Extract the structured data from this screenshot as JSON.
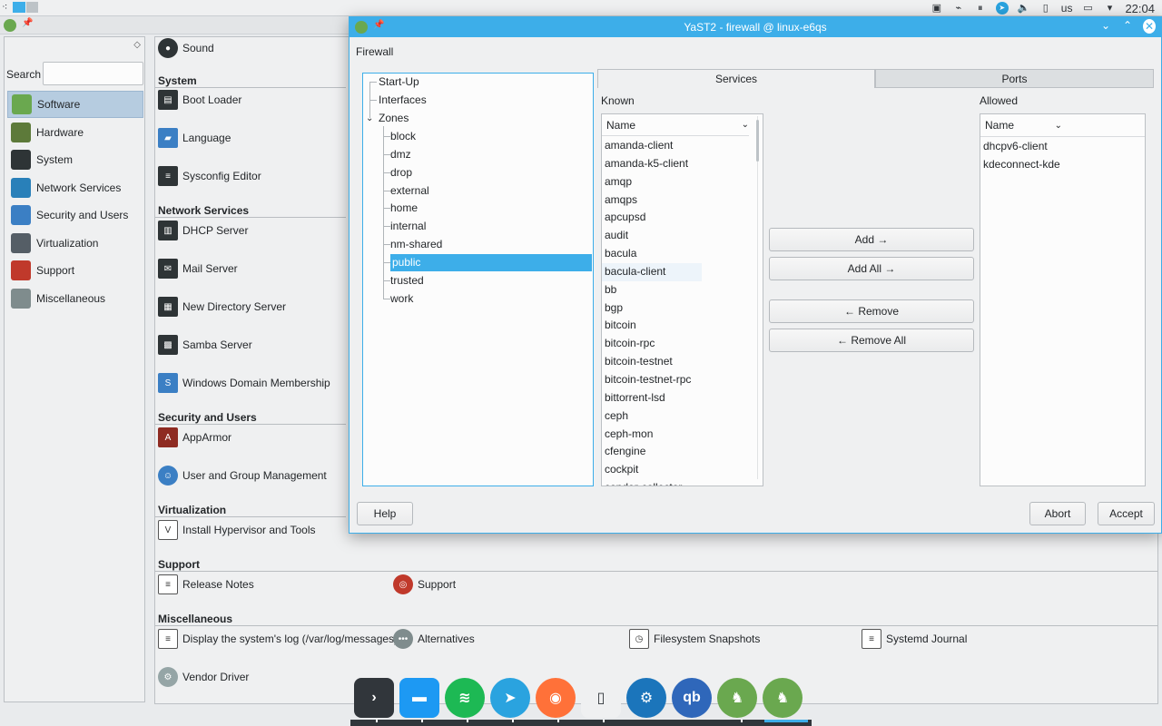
{
  "top_panel": {
    "keyboard_layout": "us",
    "clock": "22:04",
    "tray_icons": [
      "screenshot-icon",
      "network-icon",
      "pause-icon",
      "telegram-icon",
      "volume-icon",
      "battery-icon",
      "display-icon",
      "chevron-down-icon"
    ]
  },
  "control_center": {
    "search_label": "Search",
    "categories": [
      {
        "label": "Software",
        "icon": "software-icon",
        "color": "#6aa84f",
        "selected": true
      },
      {
        "label": "Hardware",
        "icon": "hardware-icon",
        "color": "#5d7a3a"
      },
      {
        "label": "System",
        "icon": "system-icon",
        "color": "#2e3436"
      },
      {
        "label": "Network Services",
        "icon": "globe-icon",
        "color": "#2980b9"
      },
      {
        "label": "Security and Users",
        "icon": "shield-icon",
        "color": "#3b7fc4"
      },
      {
        "label": "Virtualization",
        "icon": "virtualization-icon",
        "color": "#555e66"
      },
      {
        "label": "Support",
        "icon": "lifebuoy-icon",
        "color": "#c0392b"
      },
      {
        "label": "Miscellaneous",
        "icon": "more-icon",
        "color": "#7f8c8d"
      }
    ],
    "sections": {
      "system": "System",
      "network_services": "Network Services",
      "security_and_users": "Security and Users",
      "virtualization": "Virtualization",
      "support": "Support",
      "miscellaneous": "Miscellaneous"
    },
    "modules": {
      "sound": "Sound",
      "boot_loader": "Boot Loader",
      "language": "Language",
      "sysconfig_editor": "Sysconfig Editor",
      "dhcp_server": "DHCP Server",
      "mail_server": "Mail Server",
      "new_directory_server": "New Directory Server",
      "samba_server": "Samba Server",
      "windows_domain_membership": "Windows Domain Membership",
      "apparmor": "AppArmor",
      "user_group_management": "User and Group Management",
      "install_hypervisor": "Install Hypervisor and Tools",
      "release_notes": "Release Notes",
      "support": "Support",
      "system_log": "Display the system's log (/var/log/messages)",
      "alternatives": "Alternatives",
      "filesystem_snapshots": "Filesystem Snapshots",
      "systemd_journal": "Systemd Journal",
      "vendor_driver": "Vendor Driver"
    }
  },
  "dock": {
    "apps": [
      {
        "name": "konsole",
        "glyph": "›",
        "color": "#31363b"
      },
      {
        "name": "files",
        "glyph": "▬",
        "color": "#1d99f3"
      },
      {
        "name": "spotify",
        "glyph": "≋",
        "color": "#1db954"
      },
      {
        "name": "telegram",
        "glyph": "➤",
        "color": "#2aa3df"
      },
      {
        "name": "firefox",
        "glyph": "◉",
        "color": "#ff7139"
      },
      {
        "name": "kdeconnect",
        "glyph": "▯",
        "color": "#eff0f1"
      },
      {
        "name": "steam",
        "glyph": "⚙",
        "color": "#1b75bb"
      },
      {
        "name": "qbittorrent",
        "glyph": "qb",
        "color": "#2f67ba"
      },
      {
        "name": "yast",
        "glyph": "♞",
        "color": "#6aa84f"
      },
      {
        "name": "yast-2",
        "glyph": "♞",
        "color": "#6aa84f"
      }
    ]
  },
  "dialog": {
    "title": "YaST2 - firewall @ linux-e6qs",
    "heading": "Firewall",
    "tree": {
      "startup": "Start-Up",
      "interfaces": "Interfaces",
      "zones": "Zones",
      "zone_items": [
        "block",
        "dmz",
        "drop",
        "external",
        "home",
        "internal",
        "nm-shared",
        "public",
        "trusted",
        "work"
      ],
      "selected_zone": "public"
    },
    "tabs": {
      "services": "Services",
      "ports": "Ports"
    },
    "known": {
      "label": "Known",
      "column": "Name",
      "items": [
        "amanda-client",
        "amanda-k5-client",
        "amqp",
        "amqps",
        "apcupsd",
        "audit",
        "bacula",
        "bacula-client",
        "bb",
        "bgp",
        "bitcoin",
        "bitcoin-rpc",
        "bitcoin-testnet",
        "bitcoin-testnet-rpc",
        "bittorrent-lsd",
        "ceph",
        "ceph-mon",
        "cfengine",
        "cockpit",
        "condor-collector"
      ]
    },
    "allowed": {
      "label": "Allowed",
      "column": "Name",
      "items": [
        "dhcpv6-client",
        "kdeconnect-kde"
      ]
    },
    "buttons": {
      "add": "Add →",
      "add_all": "Add All →",
      "remove": "← Remove",
      "remove_all": "← Remove All",
      "help": "Help",
      "abort": "Abort",
      "accept": "Accept"
    }
  }
}
